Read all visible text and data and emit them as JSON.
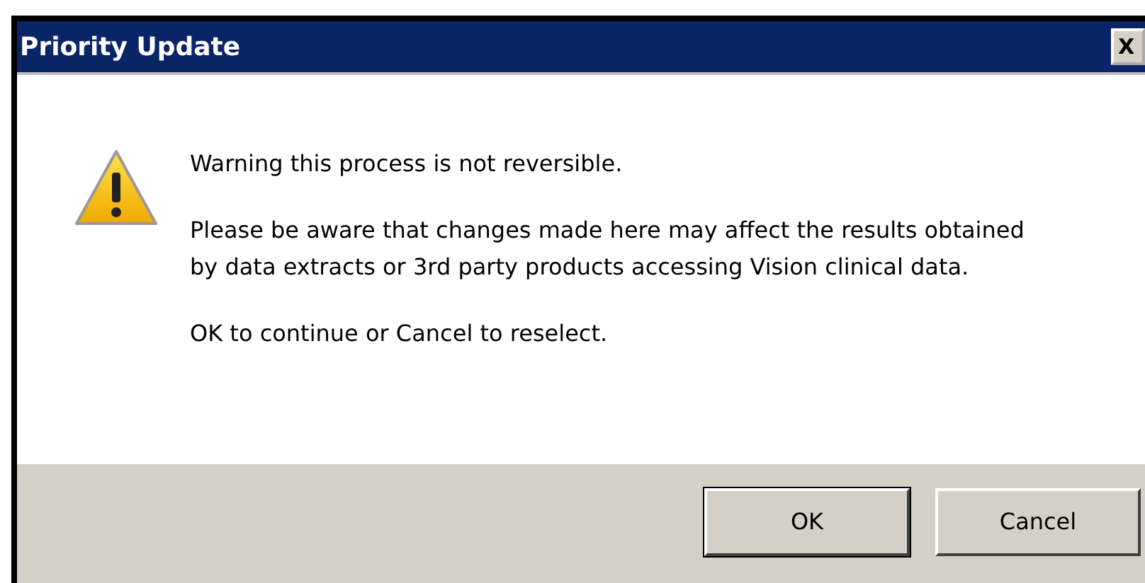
{
  "window": {
    "title": "Priority Update",
    "close_button": "X"
  },
  "message": {
    "heading": "Warning this process is not reversible.",
    "body": "Please be aware that changes made here may affect the results obtained by data extracts or 3rd party products accessing Vision clinical data.",
    "prompt": "OK to continue or Cancel to reselect."
  },
  "buttons": [
    {
      "label": "OK",
      "default": true
    },
    {
      "label": "Cancel",
      "default": false
    }
  ]
}
